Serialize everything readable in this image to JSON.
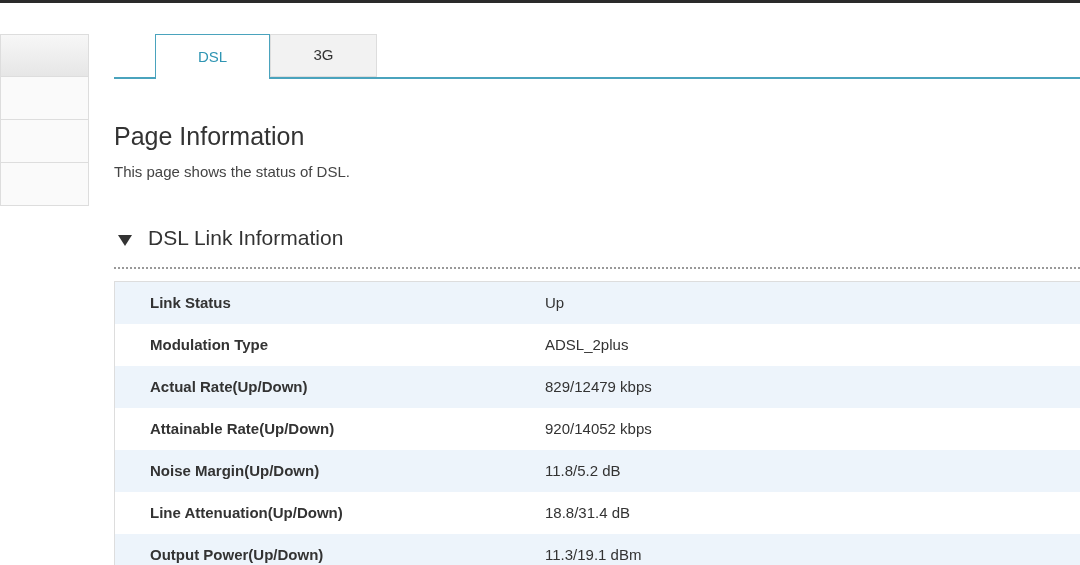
{
  "sidebar": {
    "items": [
      {
        "selected": true
      },
      {
        "selected": false
      },
      {
        "selected": false
      },
      {
        "selected": false
      }
    ]
  },
  "tabs": [
    {
      "label": "DSL",
      "selected": true
    },
    {
      "label": "3G",
      "selected": false
    }
  ],
  "page_title": "Page Information",
  "description": "This page shows the status of DSL.",
  "section": {
    "title": "DSL Link Information",
    "expanded": true,
    "rows": [
      {
        "label": "Link Status",
        "value": "Up"
      },
      {
        "label": "Modulation Type",
        "value": "ADSL_2plus"
      },
      {
        "label": "Actual Rate(Up/Down)",
        "value": "829/12479 kbps"
      },
      {
        "label": "Attainable Rate(Up/Down)",
        "value": "920/14052 kbps"
      },
      {
        "label": "Noise Margin(Up/Down)",
        "value": "11.8/5.2 dB"
      },
      {
        "label": "Line Attenuation(Up/Down)",
        "value": "18.8/31.4 dB"
      },
      {
        "label": "Output Power(Up/Down)",
        "value": "11.3/19.1 dBm"
      }
    ]
  }
}
